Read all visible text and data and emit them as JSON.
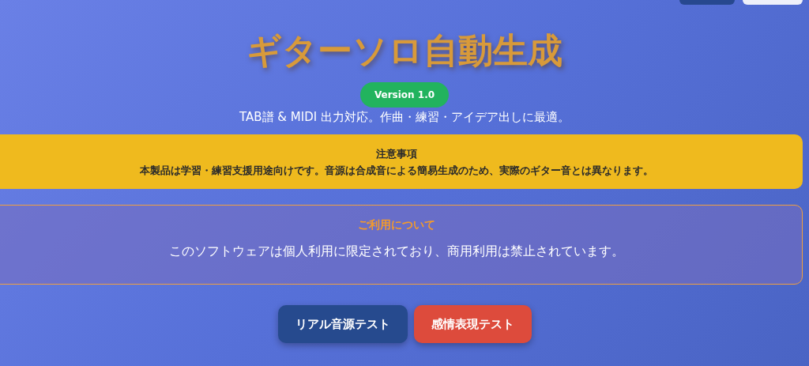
{
  "title": "ギターソロ自動生成",
  "version_badge": "Version 1.0",
  "subtitle": "TAB譜 & MIDI 出力対応。作曲・練習・アイデア出しに最適。",
  "notice": {
    "heading": "注意事項",
    "text": "本製品は学習・練習支援用途向けです。音源は合成音による簡易生成のため、実際のギター音とは異なります。"
  },
  "usage": {
    "heading": "ご利用について",
    "text": "このソフトウェアは個人利用に限定されており、商用利用は禁止されています。"
  },
  "buttons": [
    {
      "label": "リアル音源テスト",
      "kind": "blue"
    },
    {
      "label": "感情表現テスト",
      "kind": "red"
    }
  ]
}
